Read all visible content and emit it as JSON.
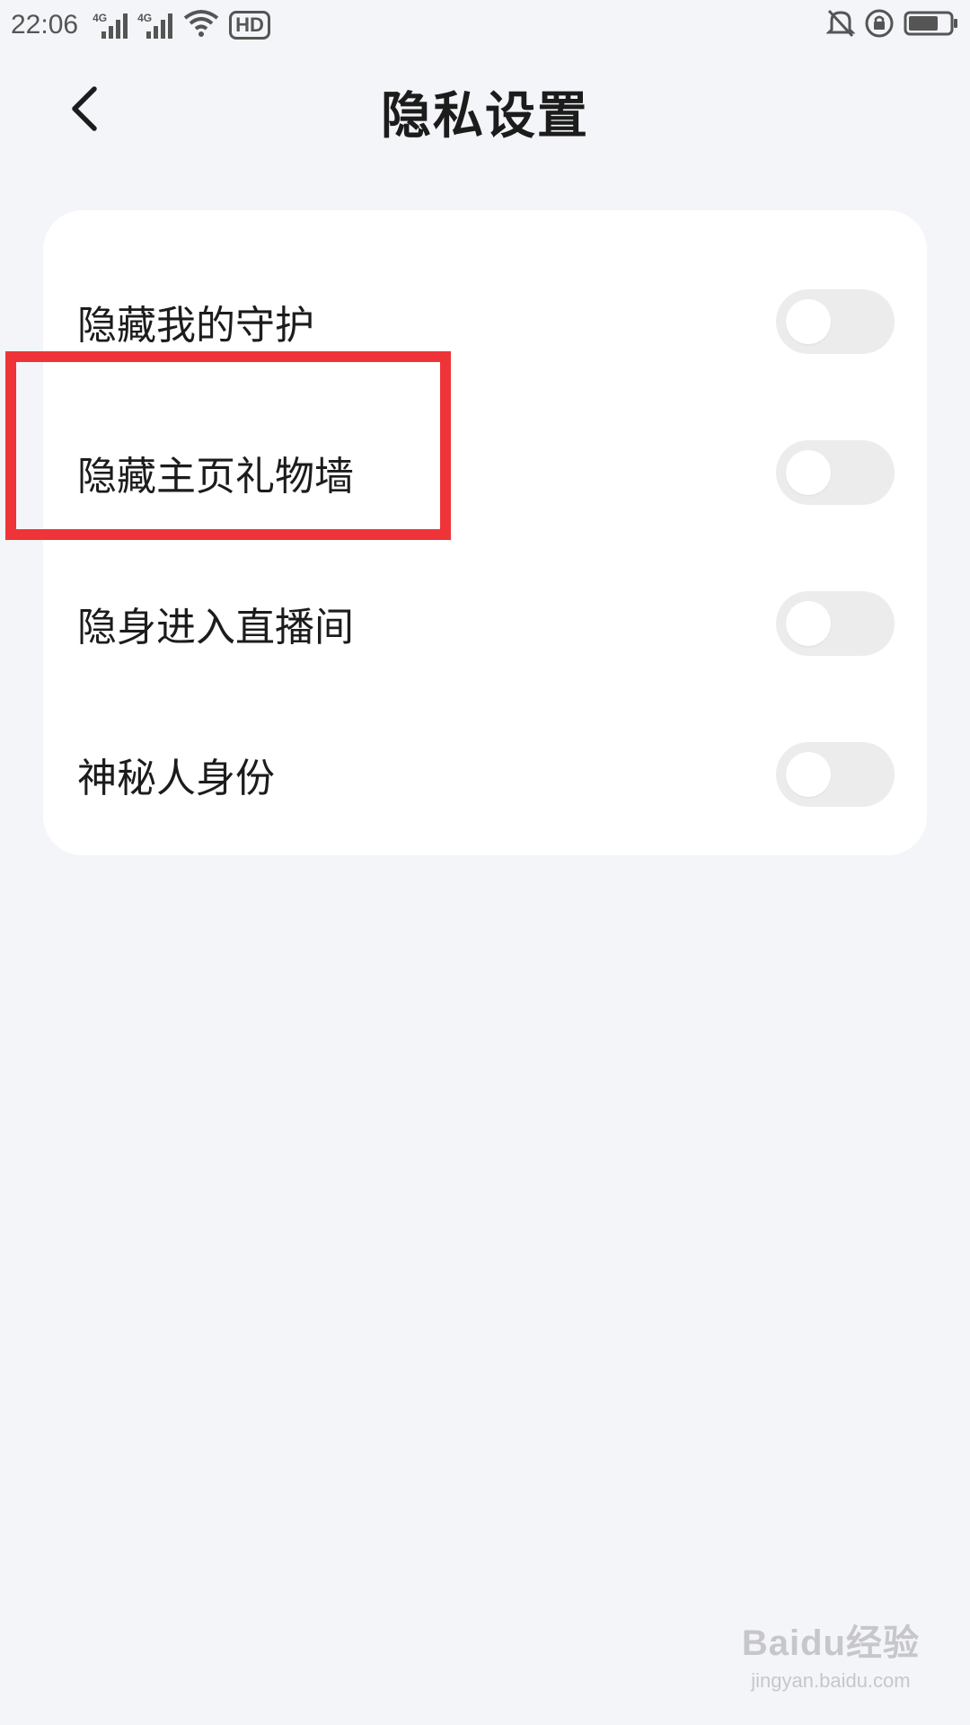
{
  "status_bar": {
    "time": "22:06",
    "network_1": "4G",
    "network_2": "4G",
    "hd_label": "HD",
    "icons": [
      "signal-icon",
      "signal-icon",
      "wifi-icon",
      "hd-call-icon",
      "bell-muted-icon",
      "rotation-lock-icon",
      "battery-icon"
    ],
    "battery_level": 0.6
  },
  "header": {
    "title": "隐私设置",
    "back_icon": "chevron-left-icon"
  },
  "settings": {
    "items": [
      {
        "label": "隐藏我的守护",
        "enabled": false
      },
      {
        "label": "隐藏主页礼物墙",
        "enabled": false
      },
      {
        "label": "隐身进入直播间",
        "enabled": false
      },
      {
        "label": "神秘人身份",
        "enabled": false
      }
    ]
  },
  "annotation": {
    "highlight_color": "#ee3438",
    "highlighted_item": "隐藏主页礼物墙"
  },
  "watermark": {
    "logo": "Baidu经验",
    "url": "jingyan.baidu.com"
  },
  "colors": {
    "background": "#f4f5f9",
    "card": "#ffffff",
    "toggle_off": "#ececec",
    "text": "#1c1c1c"
  }
}
